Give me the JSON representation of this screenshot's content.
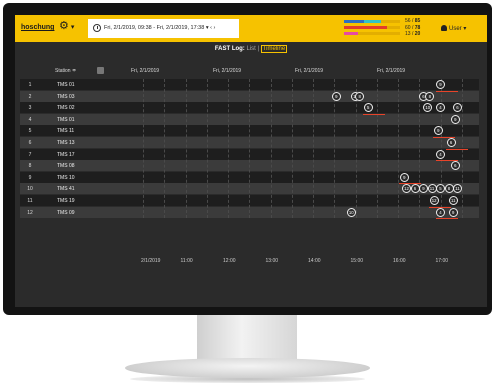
{
  "header": {
    "logo": "hoschung",
    "date_range": "Fri, 2/1/2019, 09:38 - Fri, 2/1/2019, 17:38",
    "range_caret": "▾",
    "nav_prev": "‹",
    "nav_next": "›",
    "stats": [
      {
        "value": "56",
        "total": "85",
        "fraction": 0.66,
        "color": "#2f6fbf",
        "color2": "#33c3c6",
        "fraction2": 0.3
      },
      {
        "value": "60",
        "total": "78",
        "fraction": 0.77,
        "color": "#e23d2a"
      },
      {
        "value": "13",
        "total": "20",
        "fraction": 0.25,
        "color": "#e54aa3"
      }
    ],
    "user_label": "User",
    "user_caret": "▾",
    "org_icon": "organization-icon",
    "org_caret": "▾"
  },
  "title": {
    "text": "FAST Log:",
    "tab_list": "List",
    "separator": "|",
    "tab_timeline": "Timeline"
  },
  "columns": {
    "station": "Station",
    "sort_indicator": "≑",
    "date_headers": [
      "Fri, 2/1/2019",
      "Fri, 2/1/2019",
      "Fri, 2/1/2019",
      "Fri, 2/1/2019"
    ]
  },
  "rows": [
    {
      "index": "1",
      "station": "TMS 01"
    },
    {
      "index": "2",
      "station": "TMS 03"
    },
    {
      "index": "3",
      "station": "TMS 02"
    },
    {
      "index": "4",
      "station": "TMS 01"
    },
    {
      "index": "5",
      "station": "TMS 11"
    },
    {
      "index": "6",
      "station": "TMS 13"
    },
    {
      "index": "7",
      "station": "TMS 17"
    },
    {
      "index": "8",
      "station": "TMS 08"
    },
    {
      "index": "9",
      "station": "TMS 10"
    },
    {
      "index": "10",
      "station": "TMS 41"
    },
    {
      "index": "11",
      "station": "TMS 19"
    },
    {
      "index": "12",
      "station": "TMS 09"
    }
  ],
  "time_axis": [
    "2/1/2019",
    "11:00",
    "12:00",
    "13:00",
    "14:00",
    "15:00",
    "16:00",
    "17:00"
  ],
  "events": [
    {
      "row": 0,
      "time": 17.0,
      "label": "9",
      "underline": true
    },
    {
      "row": 1,
      "time": 14.55,
      "label": "9",
      "underline": false
    },
    {
      "row": 1,
      "time": 15.0,
      "label": "10",
      "underline": false
    },
    {
      "row": 1,
      "time": 15.1,
      "label": "8",
      "underline": false
    },
    {
      "row": 1,
      "time": 16.6,
      "label": "6",
      "underline": false
    },
    {
      "row": 1,
      "time": 16.75,
      "label": "8",
      "underline": false
    },
    {
      "row": 2,
      "time": 15.3,
      "label": "5",
      "underline": true
    },
    {
      "row": 2,
      "time": 16.7,
      "label": "10",
      "underline": false
    },
    {
      "row": 2,
      "time": 17.0,
      "label": "4",
      "underline": false
    },
    {
      "row": 2,
      "time": 17.4,
      "label": "6",
      "underline": false
    },
    {
      "row": 3,
      "time": 17.35,
      "label": "9",
      "underline": false
    },
    {
      "row": 4,
      "time": 16.95,
      "label": "9",
      "underline": true
    },
    {
      "row": 5,
      "time": 17.25,
      "label": "6",
      "underline": true
    },
    {
      "row": 6,
      "time": 17.0,
      "label": "4",
      "underline": true
    },
    {
      "row": 7,
      "time": 17.35,
      "label": "6",
      "underline": false
    },
    {
      "row": 8,
      "time": 16.15,
      "label": "9",
      "underline": true
    },
    {
      "row": 9,
      "time": 16.2,
      "label": "12",
      "underline": false
    },
    {
      "row": 9,
      "time": 16.4,
      "label": "6",
      "underline": false
    },
    {
      "row": 9,
      "time": 16.6,
      "label": "9",
      "underline": false
    },
    {
      "row": 9,
      "time": 16.8,
      "label": "11",
      "underline": false
    },
    {
      "row": 9,
      "time": 17.0,
      "label": "5",
      "underline": false
    },
    {
      "row": 9,
      "time": 17.2,
      "label": "8",
      "underline": false
    },
    {
      "row": 9,
      "time": 17.4,
      "label": "11",
      "underline": false
    },
    {
      "row": 10,
      "time": 16.85,
      "label": "12",
      "underline": true
    },
    {
      "row": 10,
      "time": 17.3,
      "label": "11",
      "underline": false
    },
    {
      "row": 11,
      "time": 14.9,
      "label": "10",
      "underline": false
    },
    {
      "row": 11,
      "time": 17.0,
      "label": "4",
      "underline": true
    },
    {
      "row": 11,
      "time": 17.3,
      "label": "9",
      "underline": false
    }
  ]
}
